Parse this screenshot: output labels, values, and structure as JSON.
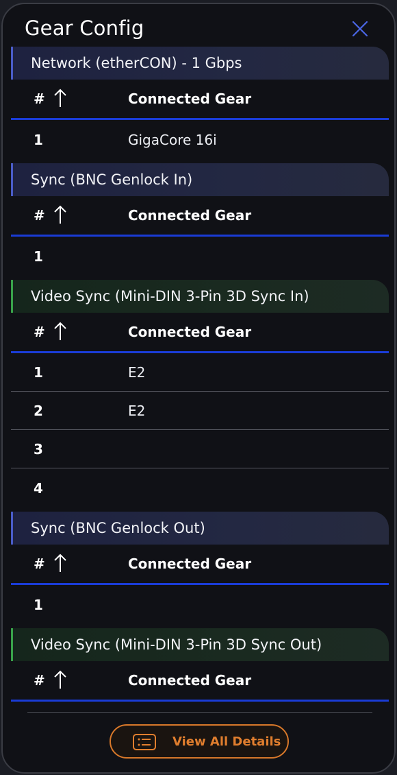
{
  "panel": {
    "title": "Gear Config"
  },
  "columns": {
    "index": "#",
    "gear": "Connected Gear"
  },
  "sections": [
    {
      "name": "Network (etherCON) - 1 Gbps",
      "rows": [
        {
          "index": "1",
          "gear": "GigaCore 16i"
        }
      ]
    },
    {
      "name": "Sync (BNC Genlock In)",
      "rows": [
        {
          "index": "1",
          "gear": ""
        }
      ]
    },
    {
      "name": "Video Sync (Mini-DIN 3-Pin 3D Sync In)",
      "rows": [
        {
          "index": "1",
          "gear": "E2"
        },
        {
          "index": "2",
          "gear": "E2"
        },
        {
          "index": "3",
          "gear": ""
        },
        {
          "index": "4",
          "gear": ""
        }
      ]
    },
    {
      "name": "Sync (BNC Genlock Out)",
      "rows": [
        {
          "index": "1",
          "gear": ""
        }
      ]
    },
    {
      "name": "Video Sync (Mini-DIN 3-Pin 3D Sync Out)",
      "rows": []
    }
  ],
  "footer": {
    "button_label": "View All Details"
  },
  "colors": {
    "accent_blue": "#1a3cd6",
    "accent_green": "#39a24a",
    "button_orange": "#e07e2e"
  },
  "icons": {
    "close": "close-icon",
    "sort": "sort-arrow-up-icon",
    "details": "list-details-icon"
  }
}
